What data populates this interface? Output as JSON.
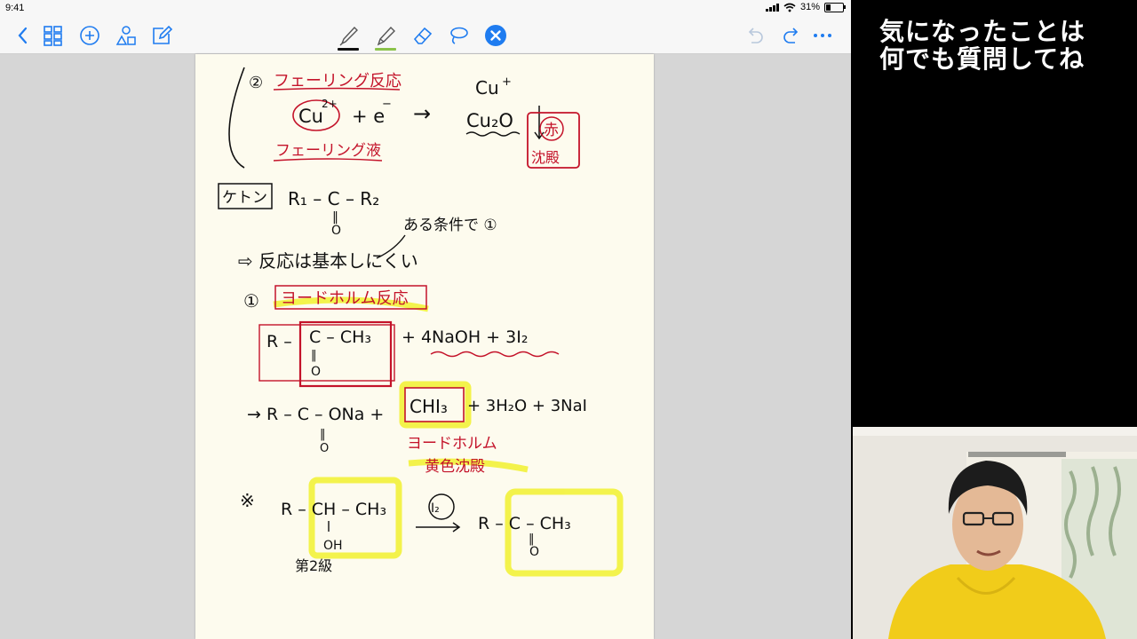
{
  "status_bar": {
    "time": "9:41",
    "battery": "31%",
    "battery_level": 0.31
  },
  "toolbar": {
    "left_icons": [
      "back-chevron-icon",
      "grid-icon",
      "plus-circle-icon",
      "shapes-icon",
      "edit-icon"
    ],
    "center_icons": [
      "pen-icon",
      "highlighter-icon",
      "eraser-icon",
      "lasso-icon",
      "close-icon"
    ],
    "right_icons": [
      "undo-icon",
      "redo-icon",
      "more-icon"
    ],
    "colors": {
      "accent": "#1f7cf0",
      "pen": "#111111",
      "highlighter": "#8bc34a"
    }
  },
  "note": {
    "aldehyde": {
      "circle_num": "②",
      "fehling_title": "フェーリング反応",
      "cu2": "Cu",
      "cu2_charge": "2+",
      "plus_e": "+ e",
      "e_charge": "−",
      "arrow": "→",
      "cu_plus": "Cu",
      "cu_plus_charge": "+",
      "cu2o": "Cu₂O",
      "red": "赤",
      "precipitate": "沈殿",
      "fehling_solution": "フェーリング液"
    },
    "ketone": {
      "label": "ケトン",
      "formula": "R₁ – C – R₂",
      "double_bond": "‖",
      "oxygen": "O",
      "condition": "ある条件で ①",
      "reaction_note": "⇨ 反応は基本しにくい",
      "circle_one": "①",
      "iodoform_title": "ヨードホルム反応",
      "reactant_r": "R –",
      "reactant_ch3": "C – CH₃",
      "reactant_o": "O",
      "reagents": "+ 4NaOH + 3I₂",
      "product": "→ R – C – ONa +",
      "product_o": "O",
      "chi3": "CHI₃",
      "byproducts": "+ 3H₂O + 3NaI",
      "iodoform_name": "ヨードホルム",
      "yellow_ppt": "黄色沈殿",
      "note_mark": "※",
      "alcohol": "R – CH – CH₃",
      "oh": "OH",
      "secondary": "第2級",
      "i2": "I₂",
      "ketone_product": "R – C – CH₃",
      "ketone_o": "O"
    }
  },
  "side_caption": {
    "line1": "気になったことは",
    "line2": "何でも質問してね"
  }
}
